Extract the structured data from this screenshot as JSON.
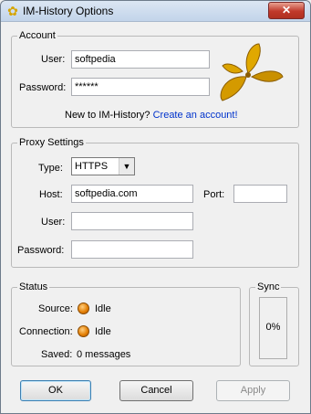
{
  "window": {
    "title": "IM-History Options",
    "close_glyph": "✕",
    "title_icon": "leaf-icon"
  },
  "account": {
    "group_label": "Account",
    "user_label": "User:",
    "user_value": "softpedia",
    "password_label": "Password:",
    "password_value": "******",
    "signup_prompt": "New to IM-History?",
    "signup_link": "Create an account!"
  },
  "proxy": {
    "group_label": "Proxy Settings",
    "type_label": "Type:",
    "type_value": "HTTPS",
    "host_label": "Host:",
    "host_value": "softpedia.com",
    "port_label": "Port:",
    "port_value": "",
    "user_label": "User:",
    "user_value": "",
    "password_label": "Password:",
    "password_value": ""
  },
  "status": {
    "group_label": "Status",
    "source_label": "Source:",
    "source_value": "Idle",
    "connection_label": "Connection:",
    "connection_value": "Idle",
    "saved_label": "Saved:",
    "saved_value": "0 messages"
  },
  "sync": {
    "group_label": "Sync",
    "percent": "0%"
  },
  "buttons": {
    "ok": "OK",
    "cancel": "Cancel",
    "apply": "Apply"
  },
  "colors": {
    "link": "#0033cc",
    "status_dot": "#e27c00",
    "title_bar": "#c2d4ea"
  }
}
